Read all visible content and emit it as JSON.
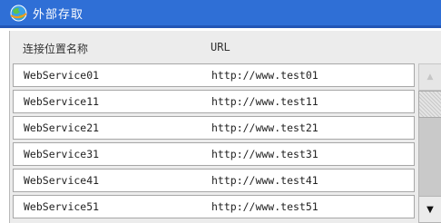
{
  "window": {
    "title": "外部存取",
    "icon": "globe-app-icon"
  },
  "table": {
    "headers": {
      "name": "连接位置名称",
      "url": "URL"
    },
    "rows": [
      {
        "name": "WebService01",
        "url": "http://www.test01"
      },
      {
        "name": "WebService11",
        "url": "http://www.test11"
      },
      {
        "name": "WebService21",
        "url": "http://www.test21"
      },
      {
        "name": "WebService31",
        "url": "http://www.test31"
      },
      {
        "name": "WebService41",
        "url": "http://www.test41"
      },
      {
        "name": "WebService51",
        "url": "http://www.test51"
      }
    ]
  },
  "scrollbar": {
    "up_icon": "triangle-up-icon",
    "down_icon": "triangle-down-icon"
  },
  "colors": {
    "titlebar": "#2f6fd6",
    "panel": "#ececec"
  }
}
